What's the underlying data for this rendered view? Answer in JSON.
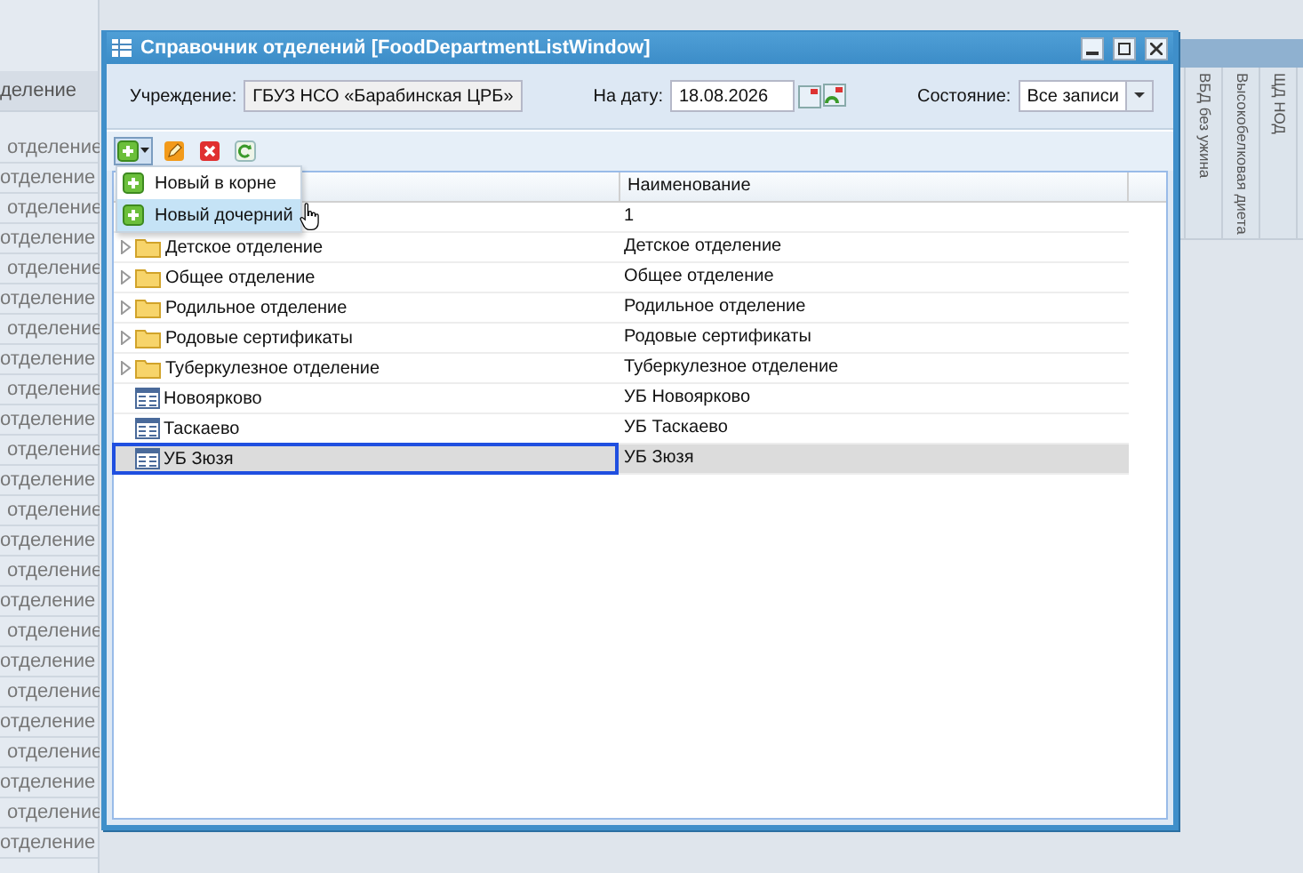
{
  "background": {
    "left_header": "деление",
    "left_rows": [
      "отделение",
      "отделение",
      "отделение",
      "отделение",
      "отделение",
      "отделение",
      "отделение",
      "отделение",
      "отделение",
      "отделение",
      "отделение",
      "отделение",
      "отделение",
      "отделение",
      "отделение",
      "отделение",
      "отделение",
      "отделение",
      "отделение",
      "отделение",
      "отделение",
      "отделение",
      "отделение",
      "отделение"
    ],
    "right_headers": [
      "ВБД без ужина",
      "Высокобелковая диета",
      "ЩД НОД"
    ]
  },
  "window": {
    "title": "Справочник отделений [FoodDepartmentListWindow]"
  },
  "filters": {
    "institution": {
      "label": "Учреждение:",
      "value": "ГБУЗ НСО «Барабинская ЦРБ»"
    },
    "date": {
      "label": "На дату:",
      "value": "18.08.2026"
    },
    "state": {
      "label": "Состояние:",
      "value": "Все записи"
    }
  },
  "toolbar": {
    "buttons": [
      {
        "kind": "add"
      },
      {
        "kind": "edit"
      },
      {
        "kind": "delete"
      },
      {
        "kind": "refresh"
      }
    ]
  },
  "add_menu": {
    "open": true,
    "items": [
      {
        "label": "Новый в корне",
        "selected": false
      },
      {
        "label": "Новый дочерний",
        "selected": true
      }
    ]
  },
  "grid": {
    "name_header": "Наименование",
    "rows": [
      {
        "kind": "covered",
        "name": "1",
        "selected": false
      },
      {
        "kind": "folder",
        "tree": "Детское отделение",
        "name": "Детское отделение",
        "selected": false
      },
      {
        "kind": "folder",
        "tree": "Общее отделение",
        "name": "Общее отделение",
        "selected": false
      },
      {
        "kind": "folder",
        "tree": "Родильное отделение",
        "name": "Родильное отделение",
        "selected": false
      },
      {
        "kind": "folder",
        "tree": "Родовые сертификаты",
        "name": "Родовые сертификаты",
        "selected": false
      },
      {
        "kind": "folder",
        "tree": "Туберкулезное отделение",
        "name": "Туберкулезное отделение",
        "selected": false
      },
      {
        "kind": "item",
        "tree": "Новоярково",
        "name": "УБ Новоярково",
        "selected": false
      },
      {
        "kind": "item",
        "tree": "Таскаево",
        "name": "УБ Таскаево",
        "selected": false
      },
      {
        "kind": "item",
        "tree": "УБ Зюзя",
        "name": "УБ Зюзя",
        "selected": true
      }
    ]
  }
}
